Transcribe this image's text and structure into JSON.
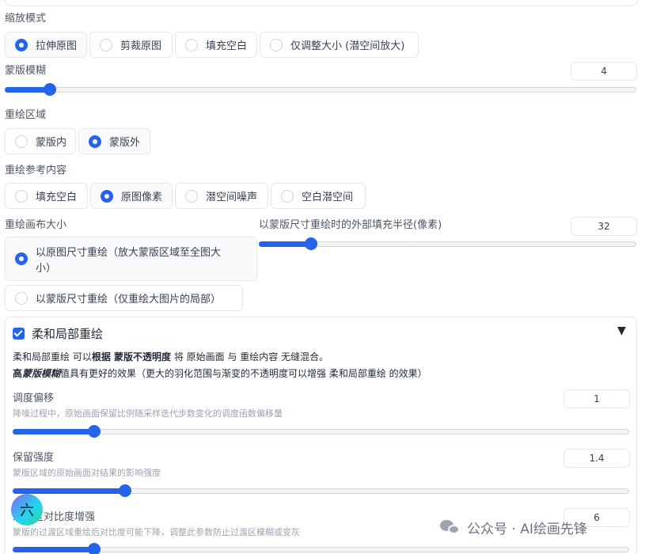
{
  "scale_mode": {
    "label": "缩放模式",
    "options": [
      "拉伸原图",
      "剪裁原图",
      "填充空白",
      "仅调整大小 (潜空间放大)"
    ],
    "selected": 0
  },
  "mask_blur": {
    "label": "蒙版模糊",
    "value": "4",
    "min": 0,
    "max": 64,
    "current": 4
  },
  "inpaint_area": {
    "label": "重绘区域",
    "options": [
      "蒙版内",
      "蒙版外"
    ],
    "selected": 1
  },
  "masked_content": {
    "label": "重绘参考内容",
    "options": [
      "填充空白",
      "原图像素",
      "潜空间噪声",
      "空白潜空间"
    ],
    "selected": 1
  },
  "inpaint_canvas": {
    "label": "重绘画布大小",
    "options": [
      "以原图尺寸重绘（放大蒙版区域至全图大",
      "小）",
      "以蒙版尺寸重绘（仅重绘大图片的局部）"
    ],
    "selected": 0
  },
  "padding": {
    "label": "以蒙版尺寸重绘时的外部填充半径(像素)",
    "value": "32",
    "min": 0,
    "max": 256,
    "current": 32
  },
  "soft_inpainting": {
    "title": "柔和局部重绘",
    "caret": "▼",
    "desc1": {
      "p1": "柔和局部重绘 可以",
      "p2": "根据 蒙版不透明度",
      "p3": " 将 原始画面 与 重绘内容 无缝混合。"
    },
    "desc2": {
      "p1": "高",
      "p2": "蒙版模糊",
      "p3": "值具有更好的效果（更大的羽化范围与渐变的不透明度可以增强 柔和局部重绘 的效果）"
    },
    "schedule_bias": {
      "label": "调度偏移",
      "sub": "降噪过程中，原始画面保留比例随采样迭代步数变化的调度函数偏移量",
      "value": "1",
      "min": 0,
      "max": 8,
      "current": 1
    },
    "preservation": {
      "label": "保留强度",
      "sub": "蒙版区域的原始画面对结果的影响强度",
      "value": "1.4",
      "min": 0,
      "max": 8,
      "current": 1.4
    },
    "transition_contrast": {
      "label": "过渡区对比度增强",
      "sub": "蒙版的过渡区域重绘后对比度可能下降，调整此参数防止过渡区模糊或变灰",
      "value": "6",
      "min": 0,
      "max": 32,
      "current": 4
    }
  },
  "badge": {
    "text": "六"
  },
  "watermark": {
    "text": "公众号 · AI绘画先锋"
  }
}
